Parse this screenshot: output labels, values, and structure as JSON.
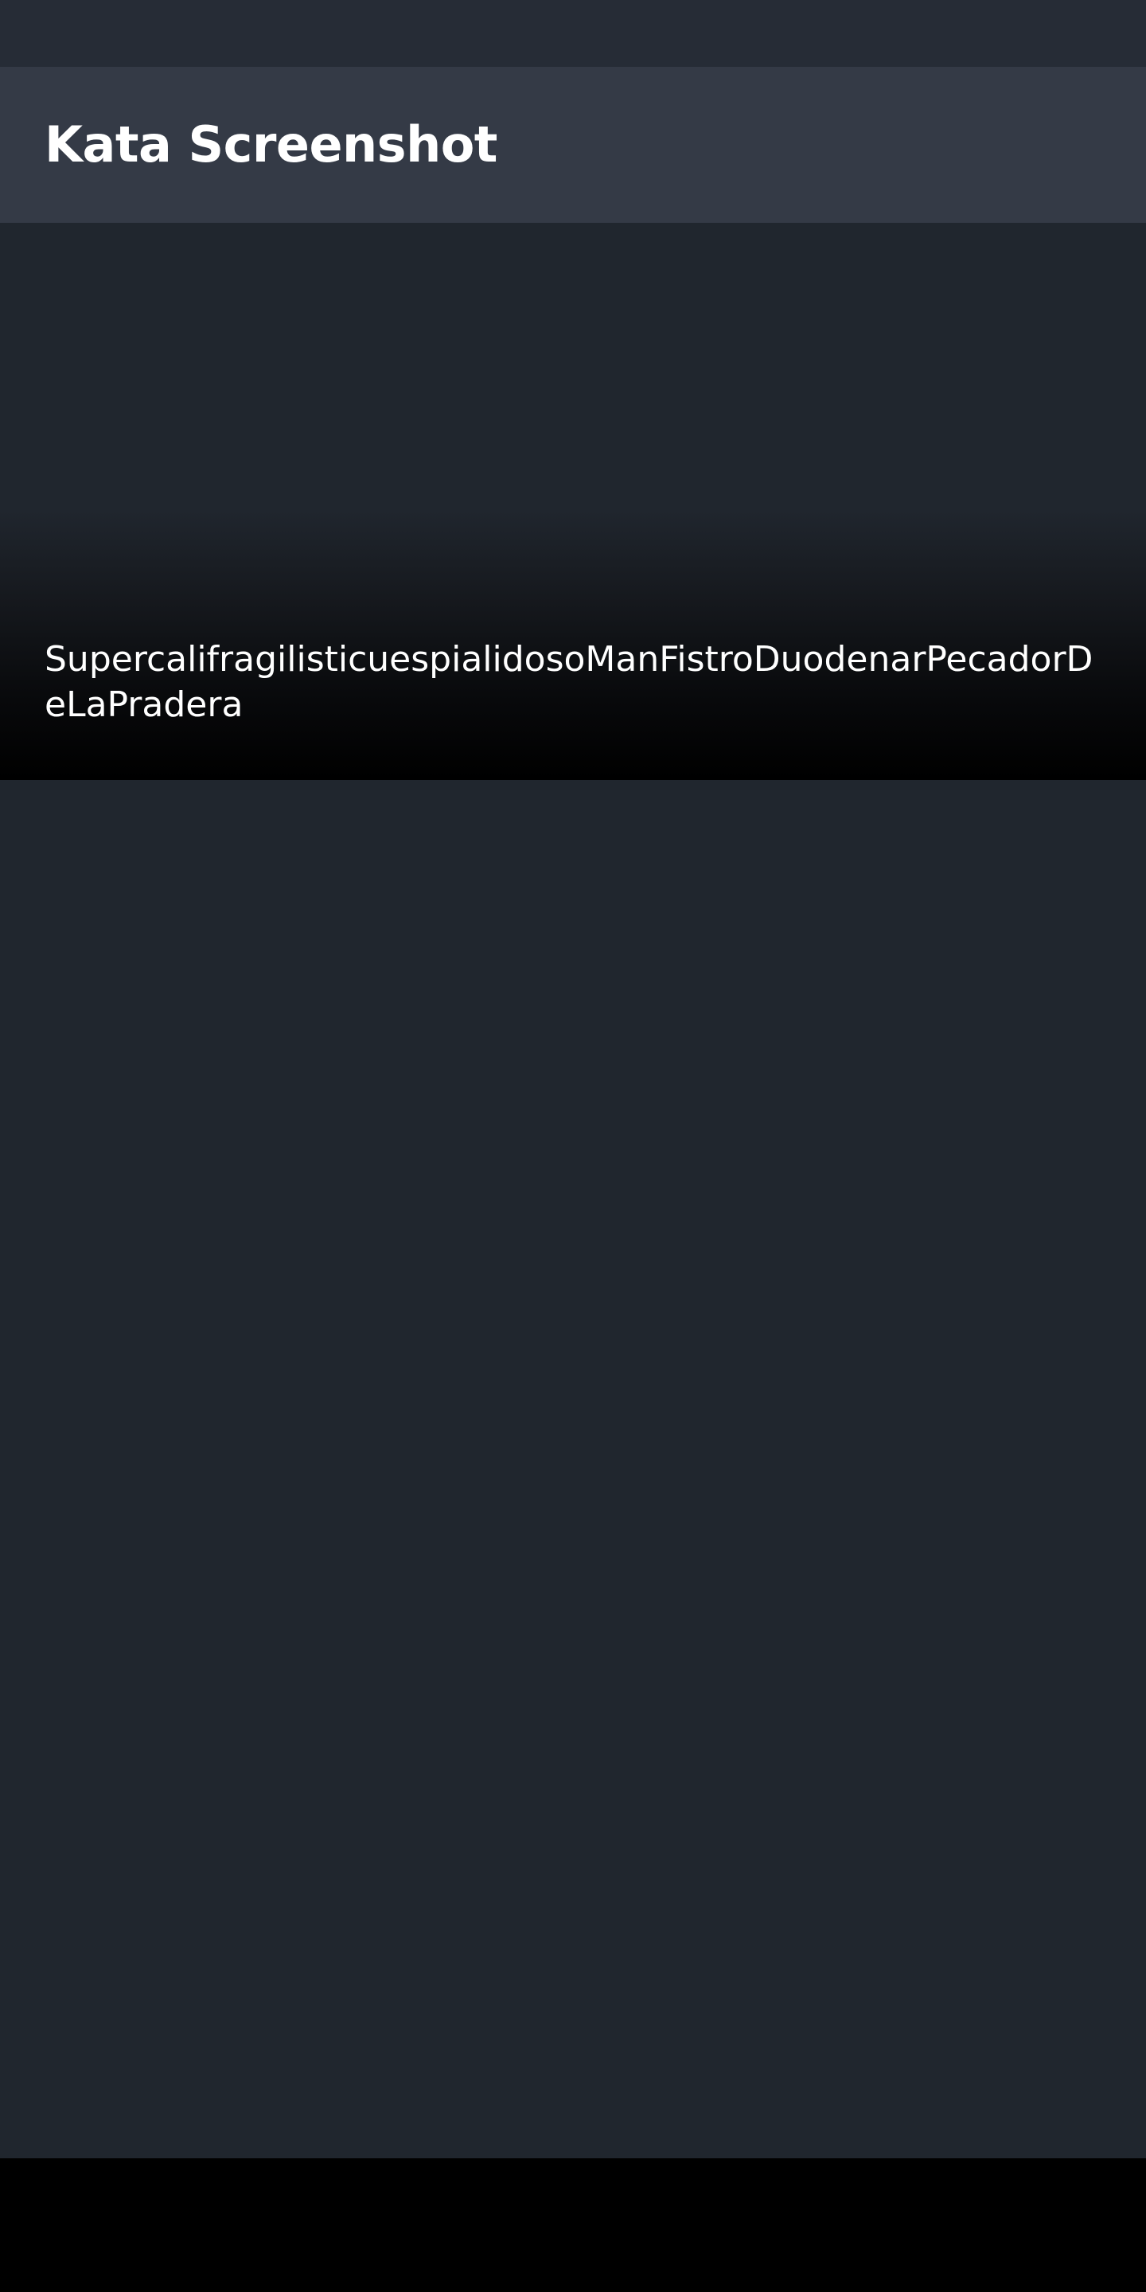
{
  "app_bar": {
    "title": "Kata Screenshot"
  },
  "hero": {
    "caption": "SupercalifragilisticuespialidosoManFistroDuodenarPecadorDeLaPradera"
  },
  "colors": {
    "status_bar": "#262c36",
    "app_bar": "#343a46",
    "content_background": "#20262e",
    "caption_text": "#ffffff",
    "navigation_bar": "#000000"
  }
}
